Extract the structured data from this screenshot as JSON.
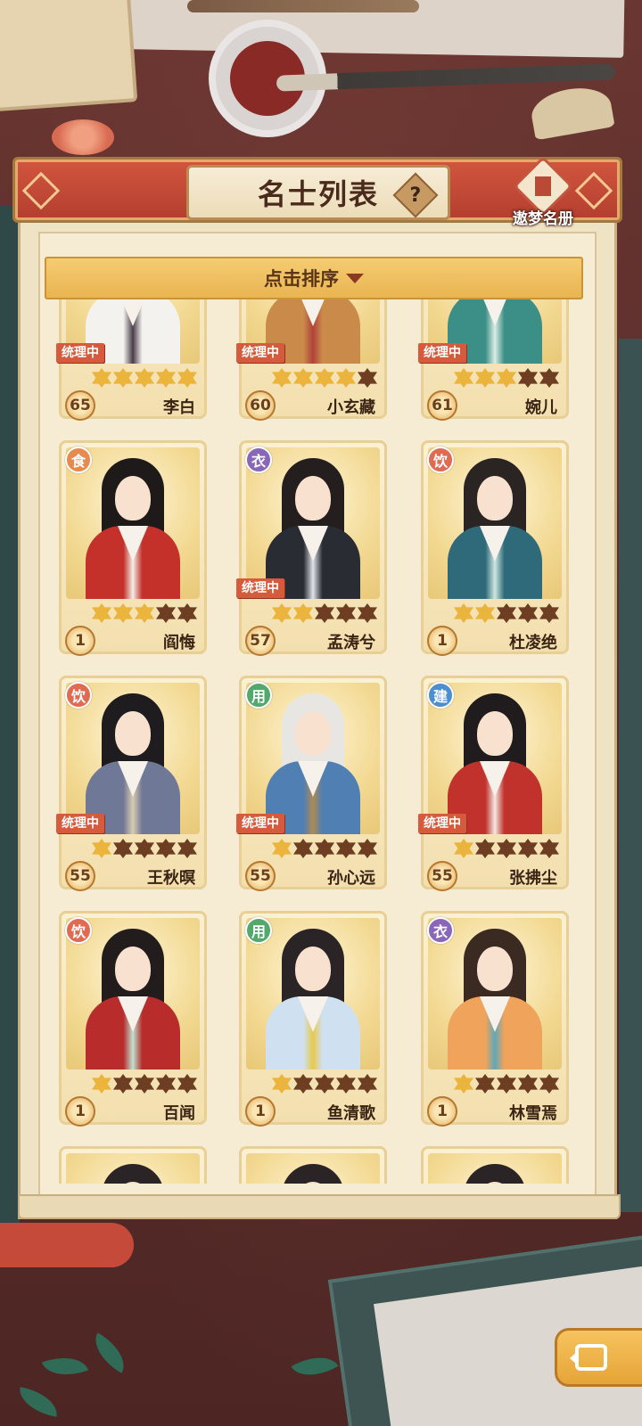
{
  "header": {
    "title": "名士列表",
    "help_glyph": "?",
    "dream_book_label": "遨梦名册"
  },
  "sort": {
    "label": "点击排序"
  },
  "colors": {
    "category_food": "#e88a4e",
    "category_clothing": "#8a66b8",
    "category_drink": "#e06a52",
    "category_use": "#53a86b",
    "category_build": "#4b8fd1",
    "star_on": "#eab43d",
    "star_off": "#6d3e22",
    "status_tag": "#d65a3c"
  },
  "cards": [
    {
      "name": "李白",
      "level": "65",
      "status": "统理中",
      "category": "",
      "category_color": "",
      "stars_filled": 5,
      "hair": "#2b2422",
      "robe": "#f4f2ee",
      "accent": "#4a3e4a"
    },
    {
      "name": "小玄藏",
      "level": "60",
      "status": "统理中",
      "category": "",
      "category_color": "",
      "stars_filled": 4,
      "hair": "#3a2a20",
      "robe": "#c98a4a",
      "accent": "#b0423a"
    },
    {
      "name": "婉儿",
      "level": "61",
      "status": "统理中",
      "category": "",
      "category_color": "",
      "stars_filled": 3,
      "hair": "#2e2620",
      "robe": "#3c8f86",
      "accent": "#d9ece4"
    },
    {
      "name": "阎悔",
      "level": "1",
      "status": "",
      "category": "食",
      "category_color": "#e88a4e",
      "stars_filled": 3,
      "hair": "#1e1a1a",
      "robe": "#c4302a",
      "accent": "#f2efe8"
    },
    {
      "name": "孟涛兮",
      "level": "57",
      "status": "统理中",
      "category": "衣",
      "category_color": "#8a66b8",
      "stars_filled": 2,
      "hair": "#241f1e",
      "robe": "#2a2c34",
      "accent": "#dfe4e8"
    },
    {
      "name": "杜凌绝",
      "level": "1",
      "status": "",
      "category": "饮",
      "category_color": "#e06a52",
      "stars_filled": 2,
      "hair": "#2a2522",
      "robe": "#2f6a7a",
      "accent": "#cfe8e0"
    },
    {
      "name": "王秋暝",
      "level": "55",
      "status": "统理中",
      "category": "饮",
      "category_color": "#e06a52",
      "stars_filled": 1,
      "hair": "#1f1c1f",
      "robe": "#6f7896",
      "accent": "#d8cbb0"
    },
    {
      "name": "孙心远",
      "level": "55",
      "status": "统理中",
      "category": "用",
      "category_color": "#53a86b",
      "stars_filled": 1,
      "hair": "#e8e6e2",
      "robe": "#4f7fb3",
      "accent": "#b08a52"
    },
    {
      "name": "张拂尘",
      "level": "55",
      "status": "统理中",
      "category": "建",
      "category_color": "#4b8fd1",
      "stars_filled": 1,
      "hair": "#201b1c",
      "robe": "#c1322d",
      "accent": "#f4e8e2"
    },
    {
      "name": "百闻",
      "level": "1",
      "status": "",
      "category": "饮",
      "category_color": "#e06a52",
      "stars_filled": 1,
      "hair": "#221c1c",
      "robe": "#b82c2c",
      "accent": "#bfe3d0"
    },
    {
      "name": "鱼清歌",
      "level": "1",
      "status": "",
      "category": "用",
      "category_color": "#53a86b",
      "stars_filled": 1,
      "hair": "#2a2426",
      "robe": "#cfe0f0",
      "accent": "#e8c94a"
    },
    {
      "name": "林雪焉",
      "level": "1",
      "status": "",
      "category": "衣",
      "category_color": "#8a66b8",
      "stars_filled": 1,
      "hair": "#3a2a22",
      "robe": "#f0a35a",
      "accent": "#5fa8b8"
    },
    {
      "name": "",
      "level": "",
      "status": "",
      "category": "",
      "category_color": "#e06a52",
      "stars_filled": 0,
      "hair": "#2a2426",
      "robe": "#b9a8d8",
      "accent": "#ffffff"
    },
    {
      "name": "",
      "level": "",
      "status": "",
      "category": "",
      "category_color": "#8a66b8",
      "stars_filled": 0,
      "hair": "#2a2426",
      "robe": "#b9a8d8",
      "accent": "#ffffff"
    },
    {
      "name": "",
      "level": "",
      "status": "",
      "category": "",
      "category_color": "#e06a52",
      "stars_filled": 0,
      "hair": "#2a2426",
      "robe": "#c8b8e0",
      "accent": "#ffffff"
    }
  ],
  "back_button": {
    "icon": "back-arrow-icon"
  }
}
